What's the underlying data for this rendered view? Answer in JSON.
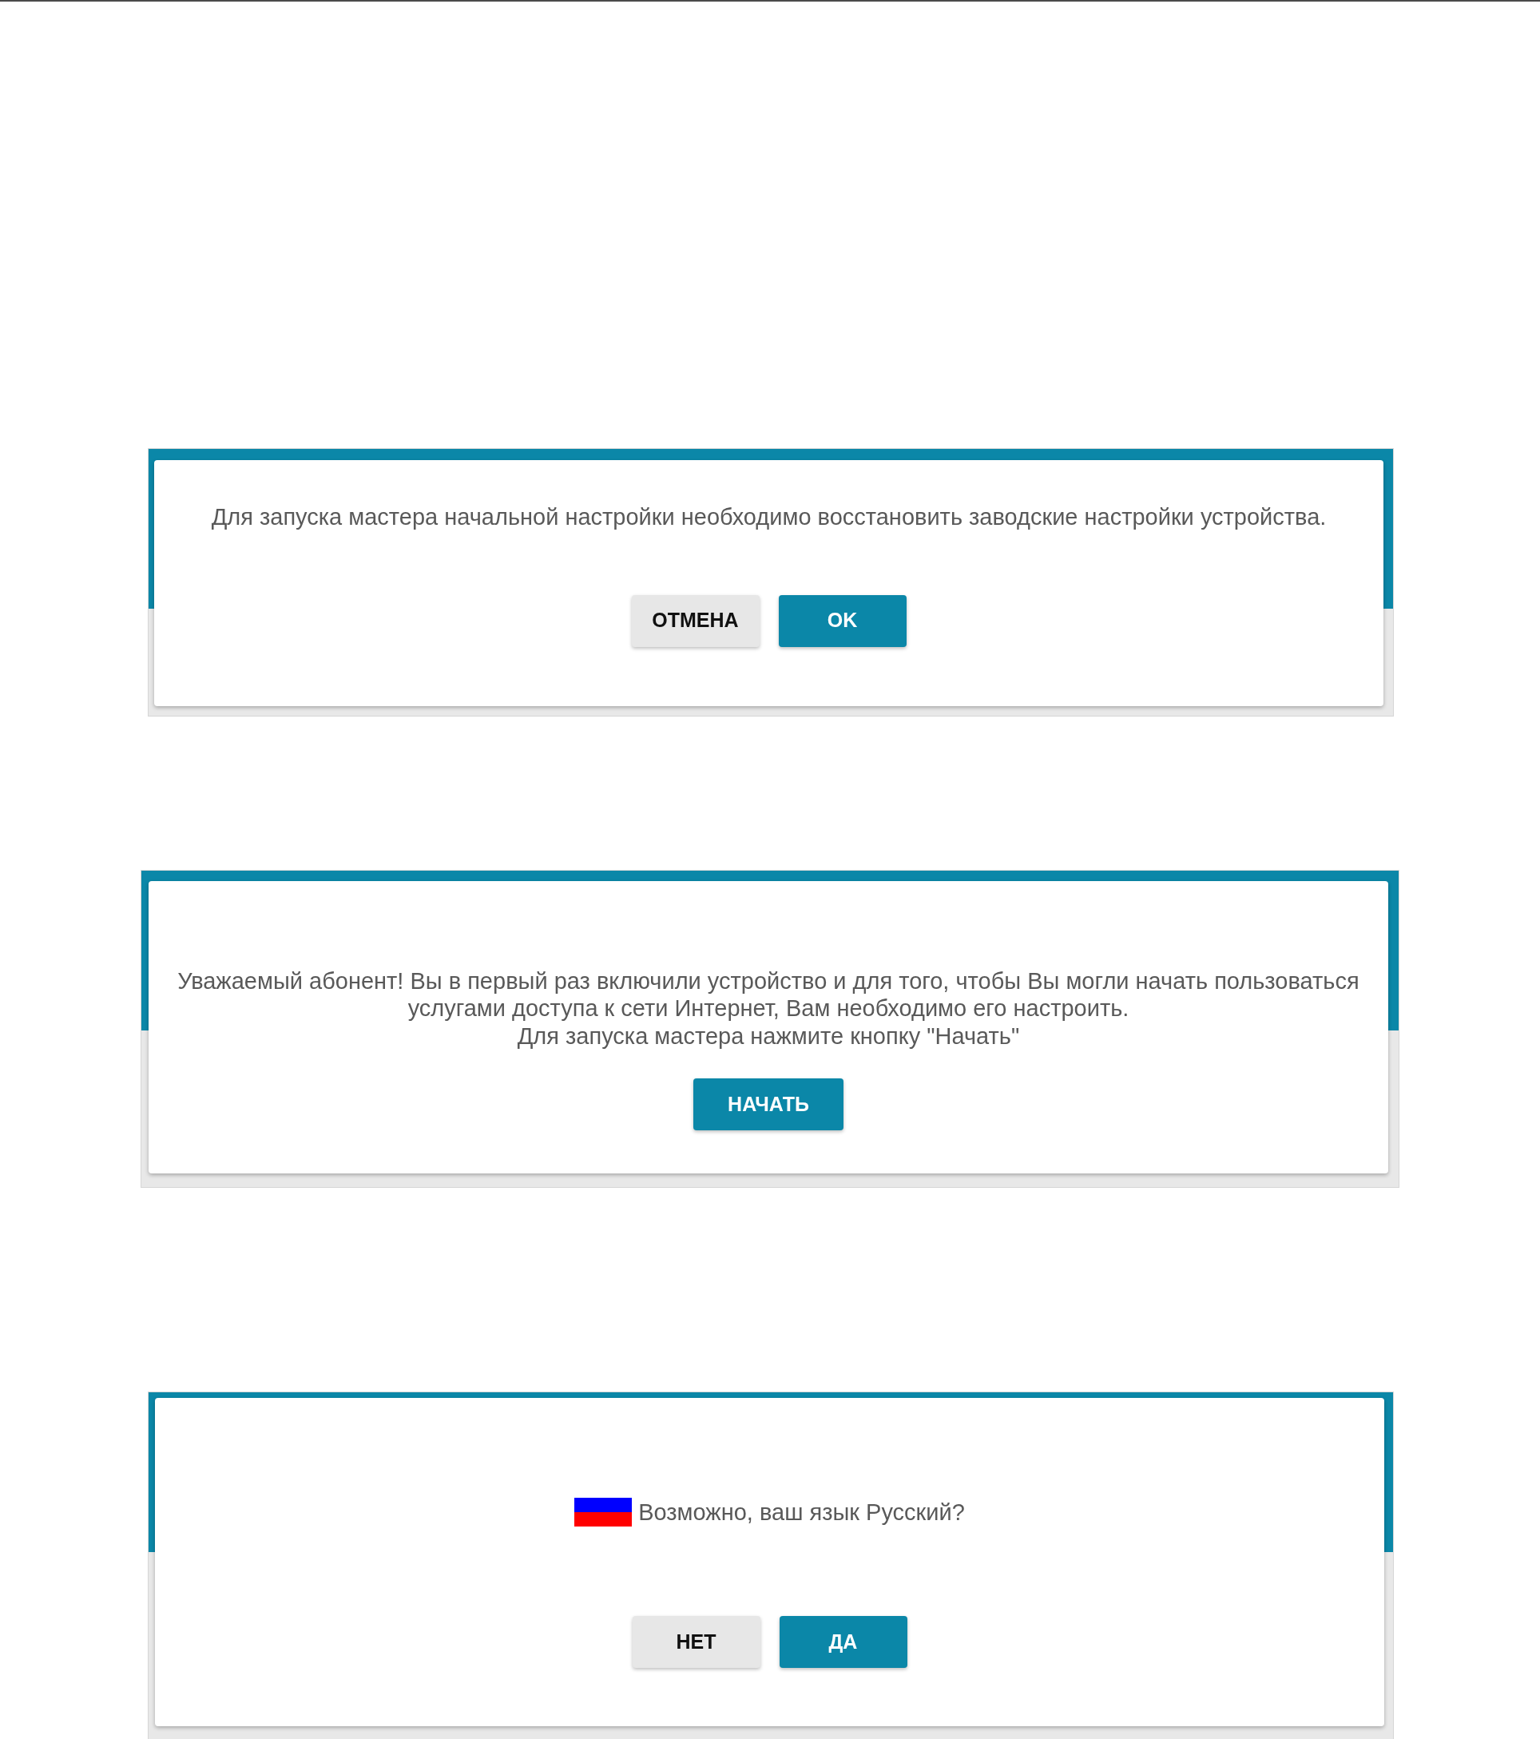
{
  "dialogs": [
    {
      "kind": "message",
      "lines": [
        "Для запуска мастера начальной настройки необходимо восстановить заводские настройки устройства."
      ],
      "buttons": [
        {
          "label": "ОТМЕНА",
          "kind": "secondary"
        },
        {
          "label": "OK",
          "kind": "primary"
        }
      ]
    },
    {
      "kind": "message",
      "lines": [
        "Уважаемый абонент! Вы в первый раз включили устройство и для того, чтобы Вы могли начать пользоваться",
        "услугами доступа к сети Интернет, Вам необходимо его настроить.",
        "Для запуска мастера нажмите кнопку \"Начать\""
      ],
      "buttons": [
        {
          "label": "НАЧАТЬ",
          "kind": "primary"
        }
      ]
    },
    {
      "kind": "language",
      "lines": [
        "Возможно, ваш язык Русский?"
      ],
      "buttons": [
        {
          "label": "НЕТ",
          "kind": "secondary"
        },
        {
          "label": "ДА",
          "kind": "primary"
        }
      ]
    }
  ]
}
